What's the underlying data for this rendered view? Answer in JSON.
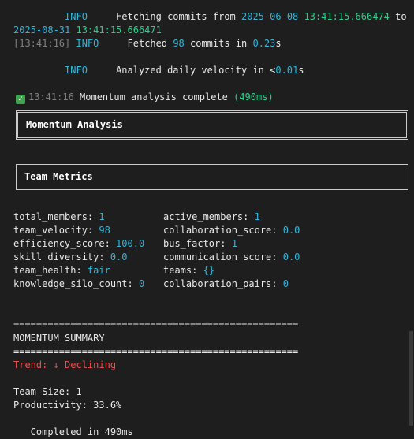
{
  "log": {
    "l1": {
      "level": "INFO",
      "msg": "Fetching commits from ",
      "from_date": "2025-06-08",
      "from_time": "13:41:15.666474",
      "to": " to"
    },
    "l2": {
      "to_date": "2025-08-31",
      "to_time": "13:41:15.666471"
    },
    "l3": {
      "ts": "[13:41:16]",
      "level": "INFO",
      "msg_a": "Fetched ",
      "count": "98",
      "msg_b": " commits in ",
      "dur": "0.23",
      "unit": "s"
    },
    "l4": {
      "level": "INFO",
      "msg_a": "Analyzed daily velocity in <",
      "dur": "0.01",
      "unit": "s"
    },
    "l5": {
      "check": "✓",
      "ts": "13:41:16",
      "msg": " Momentum analysis complete ",
      "dur": "(490ms)"
    }
  },
  "panels": {
    "momentum_title": "Momentum Analysis",
    "team_metrics_title": "Team Metrics"
  },
  "metrics": {
    "left": [
      {
        "key": "total_members: ",
        "value": "1"
      },
      {
        "key": "team_velocity: ",
        "value": "98"
      },
      {
        "key": "efficiency_score: ",
        "value": "100.0"
      },
      {
        "key": "skill_diversity: ",
        "value": "0.0"
      },
      {
        "key": "team_health: ",
        "value": "fair"
      },
      {
        "key": "knowledge_silo_count: ",
        "value": "0"
      }
    ],
    "right": [
      {
        "key": "active_members: ",
        "value": "1"
      },
      {
        "key": "collaboration_score: ",
        "value": "0.0"
      },
      {
        "key": "bus_factor: ",
        "value": "1"
      },
      {
        "key": "communication_score: ",
        "value": "0.0"
      },
      {
        "key": "teams: ",
        "value": "{}"
      },
      {
        "key": "collaboration_pairs: ",
        "value": "0"
      }
    ]
  },
  "summary": {
    "rule": "==================================================",
    "title": "MOMENTUM SUMMARY",
    "trend": "Trend: ↓ Declining",
    "team_size": "Team Size: 1",
    "productivity": "Productivity: 33.6%",
    "completed": "   Completed in 490ms"
  },
  "colors": {
    "background": "#1e1e1e",
    "cyan": "#29b8db",
    "green": "#23d18b",
    "red": "#f14c4c",
    "check": "#3fa34d"
  }
}
